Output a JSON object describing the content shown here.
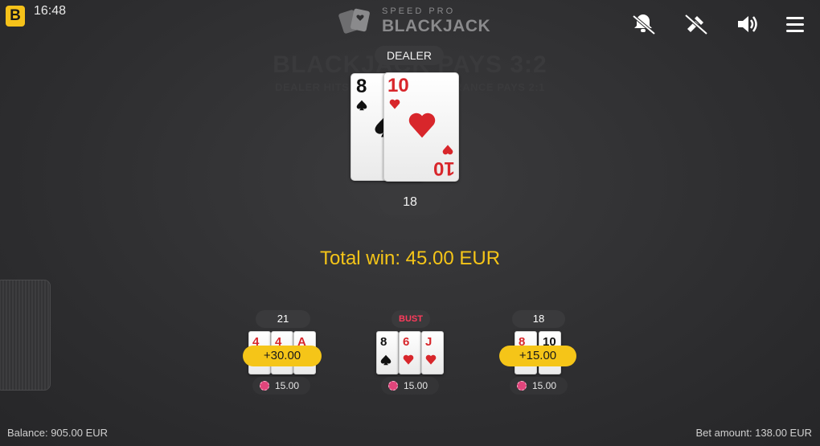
{
  "status_bar": {
    "brand_letter": "B",
    "time": "16:48"
  },
  "game_logo": {
    "line1": "SPEED PRO",
    "line2": "BLACKJACK"
  },
  "top_controls": {
    "icons": [
      "chat-off-icon",
      "video-off-icon",
      "volume-icon",
      "menu-icon"
    ]
  },
  "table": {
    "text_line1": "BLACKJACK PAYS 3:2",
    "text_line2": "DEALER HITS ON SOFT 17 · INSURANCE PAYS 2:1"
  },
  "dealer": {
    "label": "DEALER",
    "cards": [
      {
        "rank": "8",
        "suit": "spades"
      },
      {
        "rank": "10",
        "suit": "hearts"
      }
    ],
    "total": "18"
  },
  "result": {
    "total_win": "Total win: 45.00 EUR"
  },
  "players": [
    {
      "score": "21",
      "win": "+30.00",
      "bet": "15.00",
      "cards": [
        {
          "rank": "4",
          "suit": "hearts"
        },
        {
          "rank": "4",
          "suit": "hearts"
        },
        {
          "rank": "A",
          "suit": "hearts"
        }
      ]
    },
    {
      "score": "BUST",
      "win": "",
      "bet": "15.00",
      "cards": [
        {
          "rank": "8",
          "suit": "spades"
        },
        {
          "rank": "6",
          "suit": "hearts"
        },
        {
          "rank": "J",
          "suit": "hearts"
        }
      ]
    },
    {
      "score": "18",
      "win": "+15.00",
      "bet": "15.00",
      "cards": [
        {
          "rank": "8",
          "suit": "hearts"
        },
        {
          "rank": "10",
          "suit": "hearts"
        }
      ]
    }
  ],
  "footer": {
    "balance": "Balance: 905.00 EUR",
    "bet_amount": "Bet amount: 138.00 EUR"
  },
  "colors": {
    "accent": "#f5c518",
    "bust": "#ff3b5c",
    "chip": "#e0457b",
    "table": "#2f2f31"
  }
}
